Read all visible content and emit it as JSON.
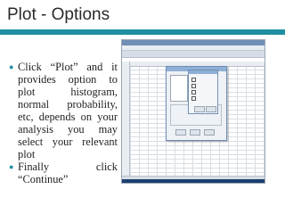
{
  "slide": {
    "title": "Plot - Options",
    "accent_color": "#1f8ea0",
    "bullets": [
      "Click “Plot” and it provides option to plot histogram, normal probability, etc, depends on your analysis you may select your relevant plot",
      "Finally click “Continue”"
    ]
  },
  "screenshot": {
    "icon": "spss-data-editor-screenshot"
  }
}
